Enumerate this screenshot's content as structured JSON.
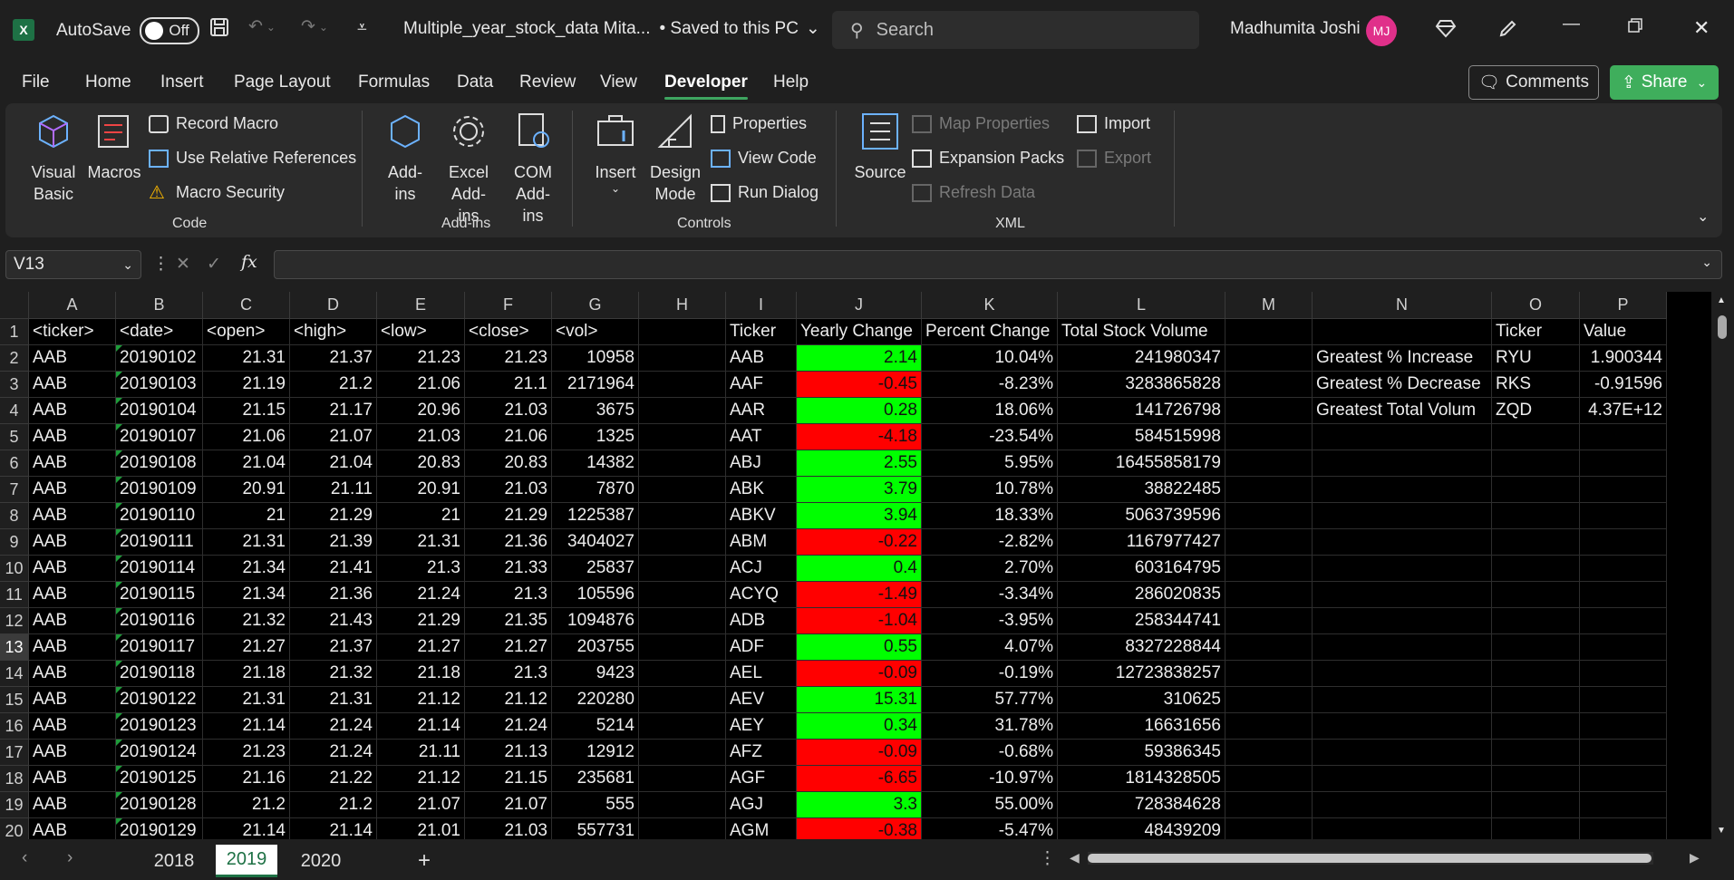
{
  "titlebar": {
    "app_icon": "X",
    "autosave_label": "AutoSave",
    "autosave_state": "Off",
    "document_title": "Multiple_year_stock_data Mita...",
    "save_status": "• Saved to this PC",
    "search_placeholder": "Search",
    "user_name": "Madhumita Joshi",
    "user_initials": "MJ"
  },
  "menu": {
    "items": [
      "File",
      "Home",
      "Insert",
      "Page Layout",
      "Formulas",
      "Data",
      "Review",
      "View",
      "Developer",
      "Help"
    ],
    "active": "Developer",
    "comments_label": "Comments",
    "share_label": "Share"
  },
  "ribbon": {
    "code": {
      "group_label": "Code",
      "visual_basic": "Visual Basic",
      "macros": "Macros",
      "record_macro": "Record Macro",
      "relative_refs": "Use Relative References",
      "macro_security": "Macro Security"
    },
    "addins": {
      "group_label": "Add-ins",
      "addins": "Add-ins",
      "excel_addins": "Excel Add-ins",
      "com_addins": "COM Add-ins"
    },
    "controls": {
      "group_label": "Controls",
      "insert": "Insert",
      "design_mode": "Design Mode",
      "properties": "Properties",
      "view_code": "View Code",
      "run_dialog": "Run Dialog"
    },
    "xml": {
      "group_label": "XML",
      "source": "Source",
      "map_properties": "Map Properties",
      "expansion_packs": "Expansion Packs",
      "refresh_data": "Refresh Data",
      "import": "Import",
      "export": "Export"
    }
  },
  "formula_bar": {
    "name_box": "V13",
    "fx": "fx",
    "formula": ""
  },
  "grid": {
    "columns": [
      "A",
      "B",
      "C",
      "D",
      "E",
      "F",
      "G",
      "H",
      "I",
      "J",
      "K",
      "L",
      "M",
      "N",
      "O",
      "P"
    ],
    "rows": [
      [
        "<ticker>",
        "<date>",
        "<open>",
        "<high>",
        "<low>",
        "<close>",
        "<vol>",
        "",
        "Ticker",
        "Yearly Change",
        "Percent Change",
        "Total Stock Volume",
        "",
        "",
        "Ticker",
        "Value"
      ],
      [
        "AAB",
        "20190102",
        "21.31",
        "21.37",
        "21.23",
        "21.23",
        "10958",
        "",
        "AAB",
        "2.14",
        "10.04%",
        "241980347",
        "",
        "Greatest % Increase",
        "RYU",
        "1.900344"
      ],
      [
        "AAB",
        "20190103",
        "21.19",
        "21.2",
        "21.06",
        "21.1",
        "2171964",
        "",
        "AAF",
        "-0.45",
        "-8.23%",
        "3283865828",
        "",
        "Greatest % Decrease",
        "RKS",
        "-0.91596"
      ],
      [
        "AAB",
        "20190104",
        "21.15",
        "21.17",
        "20.96",
        "21.03",
        "3675",
        "",
        "AAR",
        "0.28",
        "18.06%",
        "141726798",
        "",
        "Greatest Total Volum",
        "ZQD",
        "4.37E+12"
      ],
      [
        "AAB",
        "20190107",
        "21.06",
        "21.07",
        "21.03",
        "21.06",
        "1325",
        "",
        "AAT",
        "-4.18",
        "-23.54%",
        "584515998",
        "",
        "",
        "",
        ""
      ],
      [
        "AAB",
        "20190108",
        "21.04",
        "21.04",
        "20.83",
        "20.83",
        "14382",
        "",
        "ABJ",
        "2.55",
        "5.95%",
        "16455858179",
        "",
        "",
        "",
        ""
      ],
      [
        "AAB",
        "20190109",
        "20.91",
        "21.11",
        "20.91",
        "21.03",
        "7870",
        "",
        "ABK",
        "3.79",
        "10.78%",
        "38822485",
        "",
        "",
        "",
        ""
      ],
      [
        "AAB",
        "20190110",
        "21",
        "21.29",
        "21",
        "21.29",
        "1225387",
        "",
        "ABKV",
        "3.94",
        "18.33%",
        "5063739596",
        "",
        "",
        "",
        ""
      ],
      [
        "AAB",
        "20190111",
        "21.31",
        "21.39",
        "21.31",
        "21.36",
        "3404027",
        "",
        "ABM",
        "-0.22",
        "-2.82%",
        "1167977427",
        "",
        "",
        "",
        ""
      ],
      [
        "AAB",
        "20190114",
        "21.34",
        "21.41",
        "21.3",
        "21.33",
        "25837",
        "",
        "ACJ",
        "0.4",
        "2.70%",
        "603164795",
        "",
        "",
        "",
        ""
      ],
      [
        "AAB",
        "20190115",
        "21.34",
        "21.36",
        "21.24",
        "21.3",
        "105596",
        "",
        "ACYQ",
        "-1.49",
        "-3.34%",
        "286020835",
        "",
        "",
        "",
        ""
      ],
      [
        "AAB",
        "20190116",
        "21.32",
        "21.43",
        "21.29",
        "21.35",
        "1094876",
        "",
        "ADB",
        "-1.04",
        "-3.95%",
        "258344741",
        "",
        "",
        "",
        ""
      ],
      [
        "AAB",
        "20190117",
        "21.27",
        "21.37",
        "21.27",
        "21.27",
        "203755",
        "",
        "ADF",
        "0.55",
        "4.07%",
        "8327228844",
        "",
        "",
        "",
        ""
      ],
      [
        "AAB",
        "20190118",
        "21.18",
        "21.32",
        "21.18",
        "21.3",
        "9423",
        "",
        "AEL",
        "-0.09",
        "-0.19%",
        "12723838257",
        "",
        "",
        "",
        ""
      ],
      [
        "AAB",
        "20190122",
        "21.31",
        "21.31",
        "21.12",
        "21.12",
        "220280",
        "",
        "AEV",
        "15.31",
        "57.77%",
        "310625",
        "",
        "",
        "",
        ""
      ],
      [
        "AAB",
        "20190123",
        "21.14",
        "21.24",
        "21.14",
        "21.24",
        "5214",
        "",
        "AEY",
        "0.34",
        "31.78%",
        "16631656",
        "",
        "",
        "",
        ""
      ],
      [
        "AAB",
        "20190124",
        "21.23",
        "21.24",
        "21.11",
        "21.13",
        "12912",
        "",
        "AFZ",
        "-0.09",
        "-0.68%",
        "59386345",
        "",
        "",
        "",
        ""
      ],
      [
        "AAB",
        "20190125",
        "21.16",
        "21.22",
        "21.12",
        "21.15",
        "235681",
        "",
        "AGF",
        "-6.65",
        "-10.97%",
        "1814328505",
        "",
        "",
        "",
        ""
      ],
      [
        "AAB",
        "20190128",
        "21.2",
        "21.2",
        "21.07",
        "21.07",
        "555",
        "",
        "AGJ",
        "3.3",
        "55.00%",
        "728384628",
        "",
        "",
        "",
        ""
      ],
      [
        "AAB",
        "20190129",
        "21.14",
        "21.14",
        "21.01",
        "21.03",
        "557731",
        "",
        "AGM",
        "-0.38",
        "-5.47%",
        "48439209",
        "",
        "",
        "",
        ""
      ]
    ],
    "selected_row": 13,
    "positive_color": "#00ff00",
    "negative_color": "#ff0000"
  },
  "sheets": {
    "tabs": [
      "2018",
      "2019",
      "2020"
    ],
    "active": "2019",
    "add_label": "+"
  }
}
